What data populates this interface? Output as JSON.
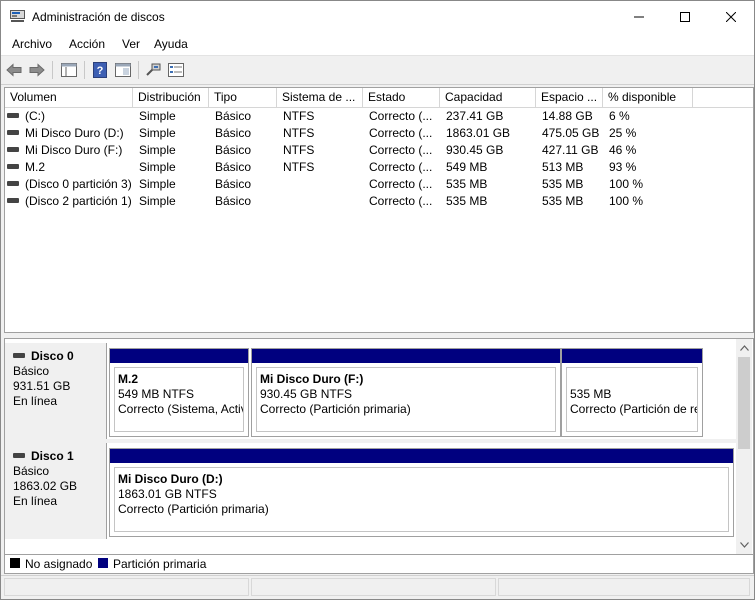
{
  "window": {
    "title": "Administración de discos"
  },
  "menu": {
    "items": [
      "Archivo",
      "Acción",
      "Ver",
      "Ayuda"
    ]
  },
  "toolbar": {
    "icons": [
      "back-arrow-icon",
      "forward-arrow-icon",
      "console-tree-icon",
      "help-icon",
      "show-pane-icon",
      "connect-icon",
      "properties-icon"
    ]
  },
  "volumes": {
    "columns": [
      "Volumen",
      "Distribución",
      "Tipo",
      "Sistema de ...",
      "Estado",
      "Capacidad",
      "Espacio ...",
      "% disponible"
    ],
    "rows": [
      [
        "(C:)",
        "Simple",
        "Básico",
        "NTFS",
        "Correcto (...",
        "237.41 GB",
        "14.88 GB",
        "6 %"
      ],
      [
        "Mi Disco Duro (D:)",
        "Simple",
        "Básico",
        "NTFS",
        "Correcto (...",
        "1863.01 GB",
        "475.05 GB",
        "25 %"
      ],
      [
        "Mi Disco Duro (F:)",
        "Simple",
        "Básico",
        "NTFS",
        "Correcto (...",
        "930.45 GB",
        "427.11 GB",
        "46 %"
      ],
      [
        "M.2",
        "Simple",
        "Básico",
        "NTFS",
        "Correcto (...",
        "549 MB",
        "513 MB",
        "93 %"
      ],
      [
        "(Disco 0 partición 3)",
        "Simple",
        "Básico",
        "",
        "Correcto (...",
        "535 MB",
        "535 MB",
        "100 %"
      ],
      [
        "(Disco 2 partición 1)",
        "Simple",
        "Básico",
        "",
        "Correcto (...",
        "535 MB",
        "535 MB",
        "100 %"
      ]
    ]
  },
  "disks": [
    {
      "name": "Disco 0",
      "type": "Básico",
      "size": "931.51 GB",
      "status": "En línea",
      "partitions": [
        {
          "title": "M.2",
          "detail": "549 MB NTFS",
          "status": "Correcto (Sistema, Activ"
        },
        {
          "title": "Mi Disco Duro  (F:)",
          "detail": "930.45 GB NTFS",
          "status": "Correcto (Partición primaria)"
        },
        {
          "title": "",
          "detail": "535 MB",
          "status": "Correcto (Partición de re"
        }
      ]
    },
    {
      "name": "Disco 1",
      "type": "Básico",
      "size": "1863.02 GB",
      "status": "En línea",
      "partitions": [
        {
          "title": "Mi Disco Duro  (D:)",
          "detail": "1863.01 GB NTFS",
          "status": "Correcto (Partición primaria)"
        }
      ]
    }
  ],
  "legend": {
    "unallocated": "No asignado",
    "primary": "Partición primaria"
  },
  "colors": {
    "primary_partition": "#00007f",
    "unallocated": "#000000"
  }
}
